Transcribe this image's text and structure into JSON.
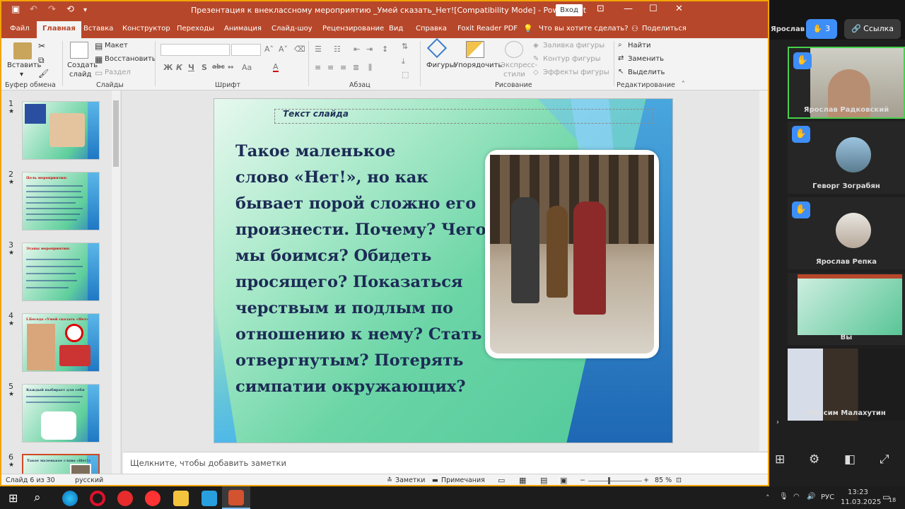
{
  "titlebar": {
    "title": "Презентация к внеклассному мероприятию _Умей сказать_Нет![Compatibility Mode]  -  PowerPoint",
    "login": "Вход"
  },
  "tabs": [
    "Файл",
    "Главная",
    "Вставка",
    "Конструктор",
    "Переходы",
    "Анимация",
    "Слайд-шоу",
    "Рецензирование",
    "Вид",
    "Справка",
    "Foxit Reader PDF",
    "Что вы хотите сделать?",
    "Поделиться"
  ],
  "ribbon": {
    "paste": "Вставить",
    "new_slide_1": "Создать",
    "new_slide_2": "слайд",
    "layout": "Макет",
    "reset": "Восстановить",
    "section": "Раздел",
    "shapes": "Фигуры",
    "arrange": "Упорядочить",
    "quick_styles_1": "Экспресс-",
    "quick_styles_2": "стили",
    "fill": "Заливка фигуры",
    "outline": "Контур фигуры",
    "effects": "Эффекты фигуры",
    "find": "Найти",
    "replace": "Заменить",
    "select": "Выделить",
    "groups": [
      "Буфер обмена",
      "Слайды",
      "Шрифт",
      "Абзац",
      "Рисование",
      "Редактирование"
    ],
    "font_buttons": [
      "Ж",
      "К",
      "Ч",
      "S",
      "abc",
      "Аа"
    ]
  },
  "thumbs": [
    {
      "num": "1",
      "title": "",
      "star": "★"
    },
    {
      "num": "2",
      "title": "Цель мероприятия:",
      "star": "★"
    },
    {
      "num": "3",
      "title": "Этапы мероприятия:",
      "star": "★"
    },
    {
      "num": "4",
      "title": "I.Беседа «Умей сказать «Нет»",
      "star": "★"
    },
    {
      "num": "5",
      "title": "Каждый выбирает для себя",
      "star": "★"
    },
    {
      "num": "6",
      "title": "Такое маленькое слово «Нет!»",
      "star": "★"
    }
  ],
  "slide": {
    "title": "Текст слайда",
    "body": "    Такое маленькое\nслово «Нет!», но как\nбывает порой сложно  его\nпроизнести. Почему? Чего\nмы боимся? Обидеть\nпросящего? Показаться\nчерствым и подлым по\nотношению к нему? Стать\nотвергнутым? Потерять\nсимпатии окружающих?"
  },
  "notes": {
    "placeholder": "Щелкните, чтобы добавить заметки"
  },
  "status": {
    "slide": "Слайд 6 из 30",
    "lang": "русский",
    "notes": "Заметки",
    "comments": "Примечания",
    "zoom": "85 %"
  },
  "meet": {
    "top_name": "Ярослав Р.",
    "hands": "3",
    "link": "Ссылка",
    "participants": [
      "Ярослав Радковский",
      "Геворг Зограбян",
      "Ярослав Репка",
      "Вы",
      "Максим Малахутин"
    ]
  },
  "tray": {
    "lang": "РУС",
    "time": "13:23",
    "date": "11.03.2025",
    "badge": "18"
  }
}
